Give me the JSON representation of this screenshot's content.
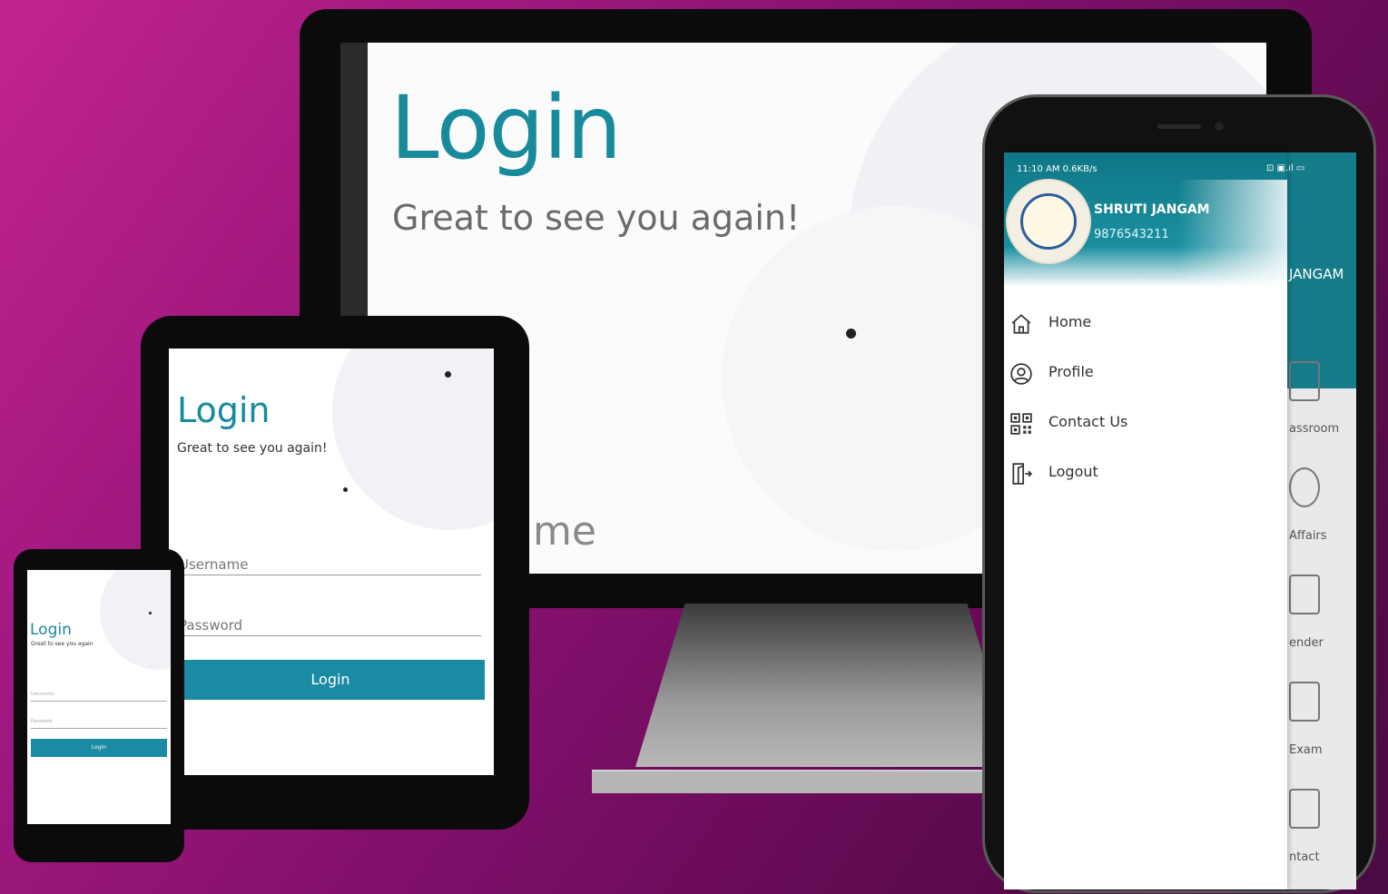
{
  "monitor": {
    "title": "Login",
    "subtitle": "Great to see you again!",
    "username_partial": "ame"
  },
  "tablet": {
    "title": "Login",
    "subtitle": "Great to see you again!",
    "username_placeholder": "Username",
    "password_placeholder": "Password",
    "login_button": "Login"
  },
  "small_phone": {
    "title": "Login",
    "subtitle": "Great to see you again",
    "username_placeholder": "Username",
    "password_placeholder": "Password",
    "login_button": "Login"
  },
  "big_phone": {
    "status_time": "11:10 AM 0.6KB/s",
    "status_icons": "⊡ ▣.ıl ▭",
    "user_name": "SHRUTI JANGAM",
    "user_phone": "9876543211",
    "menu": [
      {
        "label": "Home",
        "icon": "home-icon"
      },
      {
        "label": "Profile",
        "icon": "profile-icon"
      },
      {
        "label": "Contact Us",
        "icon": "qr-code-icon"
      },
      {
        "label": "Logout",
        "icon": "logout-icon"
      }
    ],
    "background_app": {
      "header_name": "JANGAM",
      "items": [
        "assroom",
        "Affairs",
        "ender",
        "Exam",
        "ntact"
      ]
    }
  },
  "colors": {
    "accent": "#1b8aa3",
    "title_teal": "#178a9c",
    "background": "#a0187f"
  }
}
